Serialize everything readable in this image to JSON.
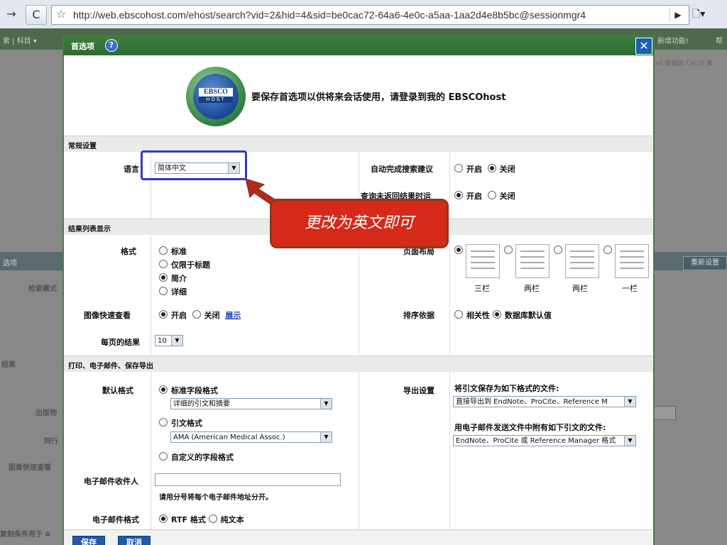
{
  "browser": {
    "back": "→",
    "reload": "C",
    "url": "http://web.ebscohost.com/ehost/search?vid=2&hid=4&sid=be0cac72-64a6-4e0c-a5aa-1aa2d4e8b5bc@sessionmgr4"
  },
  "background": {
    "nav_left": "索 | 科目 ▾",
    "nav_right_1": "新增功能!",
    "nav_right_2": "帮",
    "right_note": "ost 数据库 CALIS 集",
    "left_labels": [
      "选项",
      "检索模式",
      "结果",
      "出版物",
      "同行",
      "图像快速查看",
      "复制条件用于 A"
    ],
    "right_button": "重新设置"
  },
  "modal": {
    "title": "首选项",
    "help": "?",
    "close": "✕",
    "logo_top": "EBSCO",
    "logo_bottom": "HOST",
    "hero_text": "要保存首选项以供将来会话使用，请登录到我的 EBSCOhost",
    "sections": {
      "general": "常规设置",
      "results": "结果列表显示",
      "print": "打印、电子邮件、保存导出"
    },
    "general": {
      "language_label": "语言",
      "language_value": "简体中文",
      "autocomplete_label": "自动完成搜索建议",
      "autocomplete_on": "开启",
      "autocomplete_off": "关闭",
      "query_label": "查询未返回结果时运",
      "query_on": "开启",
      "query_off": "关闭"
    },
    "results": {
      "format_label": "格式",
      "format_options": [
        "标准",
        "仅限于标题",
        "简介",
        "详细"
      ],
      "layout_label": "页面布局",
      "layout_options": [
        "三栏",
        "两栏",
        "两栏",
        "一栏"
      ],
      "image_label": "图像快速查看",
      "image_on": "开启",
      "image_off": "关闭",
      "image_link": "展示",
      "sort_label": "排序依据",
      "sort_relevance": "相关性",
      "sort_default": "数据库默认值",
      "per_page_label": "每页的结果",
      "per_page_value": "10"
    },
    "print": {
      "default_label": "默认格式",
      "field_format": "标准字段格式",
      "field_select": "详细的引文和摘要",
      "citation_format": "引文格式",
      "citation_select": "AMA (American Medical Assoc.)",
      "custom_format": "自定义的字段格式",
      "export_label": "导出设置",
      "export_save_title": "将引文保存为如下格式的文件:",
      "export_save_select": "直接导出到 EndNote、ProCite、Reference M",
      "export_email_title": "用电子邮件发送文件中附有如下引文的文件:",
      "export_email_select": "EndNote、ProCite 或 Reference Manager 格式",
      "email_recipient_label": "电子邮件收件人",
      "email_hint": "请用分号将每个电子邮件地址分开。",
      "email_format_label": "电子邮件格式",
      "email_rtf": "RTF 格式",
      "email_plain": "纯文本"
    },
    "buttons": {
      "save": "保存",
      "cancel": "取消"
    },
    "callout": "更改为英文即可"
  }
}
